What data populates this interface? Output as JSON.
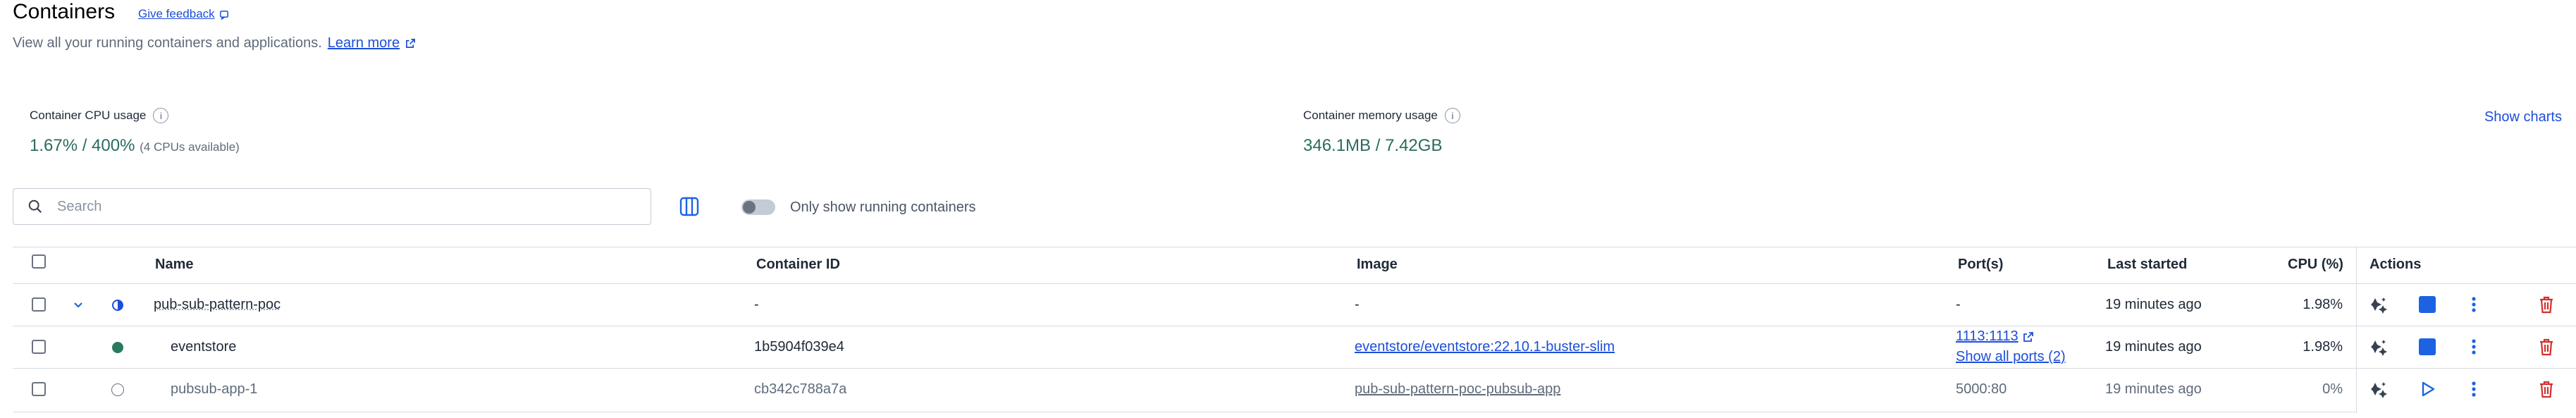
{
  "header": {
    "title": "Containers",
    "feedback_label": "Give feedback",
    "subtitle": "View all your running containers and applications.",
    "learn_more": "Learn more"
  },
  "stats": {
    "cpu_label": "Container CPU usage",
    "cpu_value": "1.67% / 400%",
    "cpu_note": "(4 CPUs available)",
    "mem_label": "Container memory usage",
    "mem_value": "346.1MB / 7.42GB",
    "show_charts": "Show charts"
  },
  "search": {
    "placeholder": "Search"
  },
  "filter": {
    "running_only_label": "Only show running containers",
    "running_only": false
  },
  "table": {
    "columns": {
      "name": "Name",
      "id": "Container ID",
      "image": "Image",
      "ports": "Port(s)",
      "last_started": "Last started",
      "cpu": "CPU (%)",
      "actions": "Actions"
    },
    "rows": [
      {
        "name": "pub-sub-pattern-poc",
        "id": "-",
        "image": "-",
        "port": "-",
        "port_extra": "",
        "last_started": "19 minutes ago",
        "cpu": "1.98%",
        "status": "partial",
        "running": true
      },
      {
        "name": "eventstore",
        "id": "1b5904f039e4",
        "image": "eventstore/eventstore:22.10.1-buster-slim",
        "port": "1113:1113",
        "port_extra": "Show all ports (2)",
        "last_started": "19 minutes ago",
        "cpu": "1.98%",
        "status": "running",
        "running": true
      },
      {
        "name": "pubsub-app-1",
        "id": "cb342c788a7a",
        "image": "pub-sub-pattern-poc-pubsub-app",
        "port": "5000:80",
        "port_extra": "",
        "last_started": "19 minutes ago",
        "cpu": "0%",
        "status": "stopped",
        "running": false
      }
    ]
  },
  "colors": {
    "accent": "#1d4ed8",
    "running": "#2a7a5e",
    "delete": "#d32f2f",
    "stat_value": "#2a6b5e"
  }
}
